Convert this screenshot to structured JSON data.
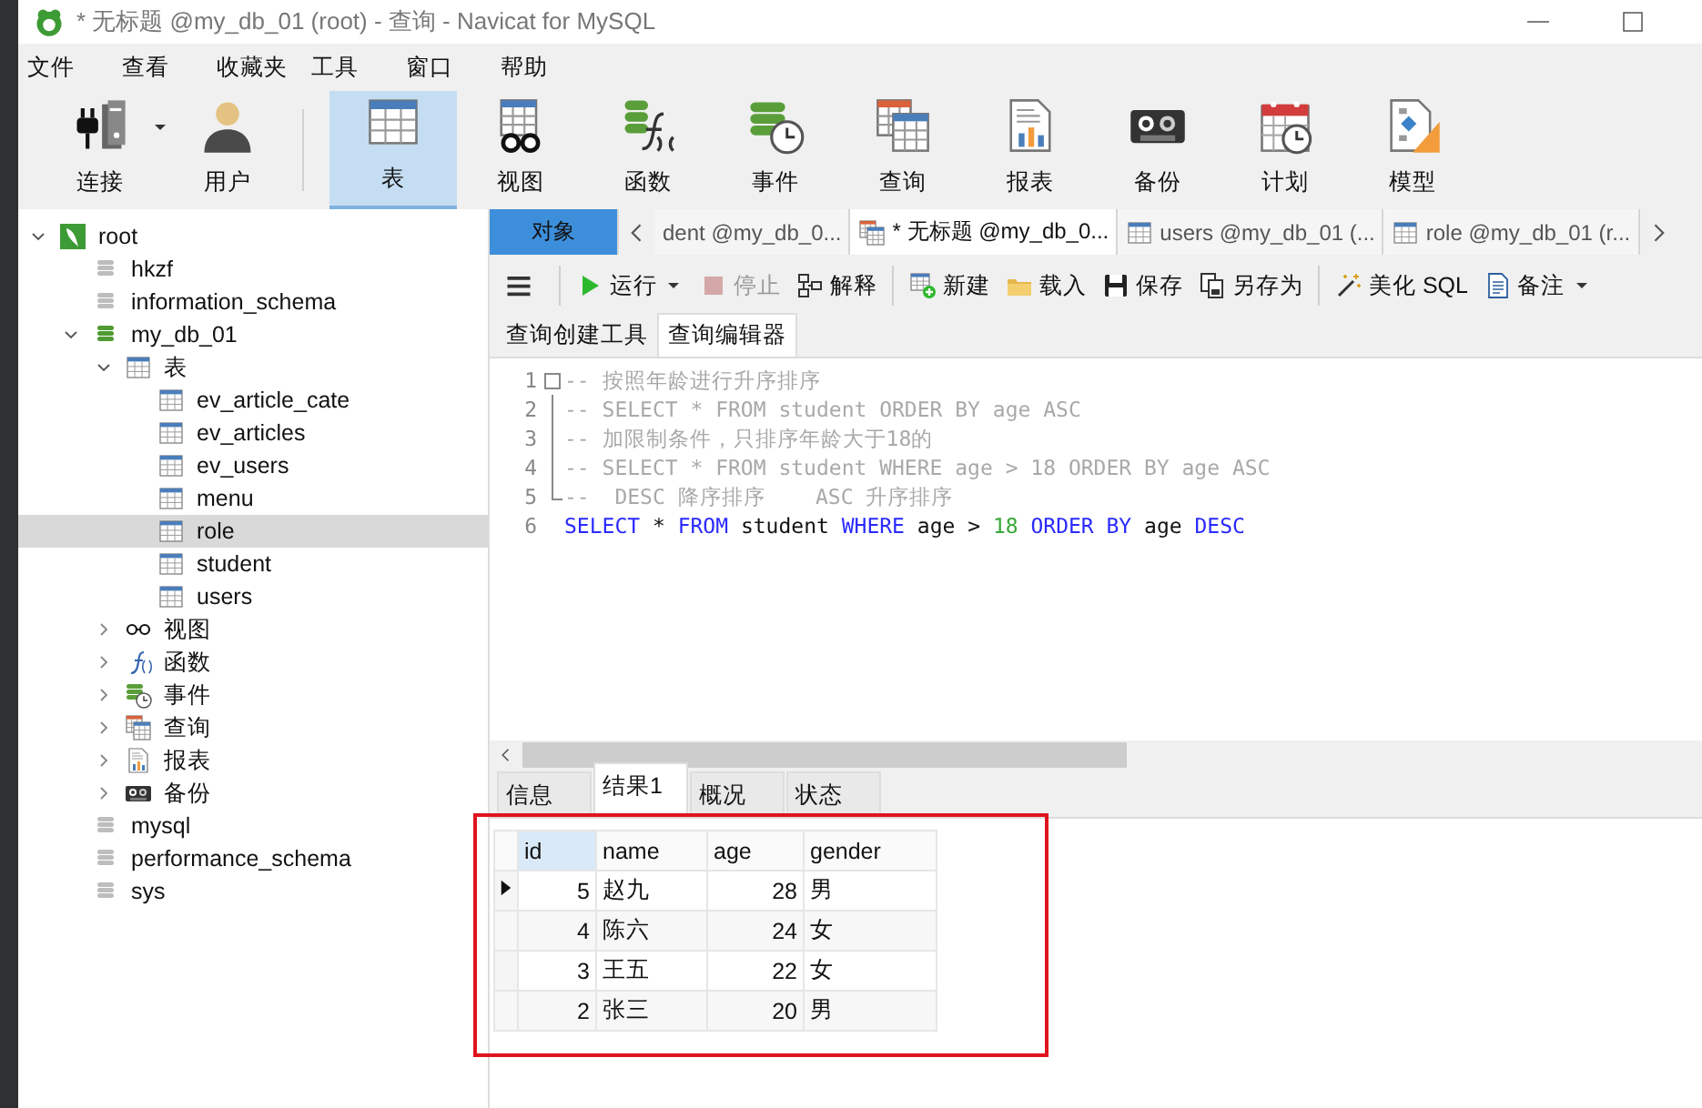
{
  "window": {
    "title": "* 无标题 @my_db_01 (root) - 查询 - Navicat for MySQL"
  },
  "menu": [
    "文件",
    "查看",
    "收藏夹",
    "工具",
    "窗口",
    "帮助"
  ],
  "toolbar": {
    "connection": [
      {
        "kind": "connect",
        "label": "连接",
        "selected": false,
        "dropdown": true
      },
      {
        "kind": "user",
        "label": "用户",
        "selected": false
      }
    ],
    "objects": [
      {
        "kind": "table",
        "label": "表",
        "selected": true
      },
      {
        "kind": "view",
        "label": "视图",
        "selected": false
      },
      {
        "kind": "function",
        "label": "函数",
        "selected": false
      },
      {
        "kind": "event",
        "label": "事件",
        "selected": false
      },
      {
        "kind": "query",
        "label": "查询",
        "selected": false
      },
      {
        "kind": "report",
        "label": "报表",
        "selected": false
      },
      {
        "kind": "backup",
        "label": "备份",
        "selected": false
      },
      {
        "kind": "schedule",
        "label": "计划",
        "selected": false
      },
      {
        "kind": "model",
        "label": "模型",
        "selected": false
      }
    ]
  },
  "tree": [
    {
      "label": "root",
      "kind": "server",
      "expanded": true,
      "children": [
        {
          "label": "hkzf",
          "kind": "db"
        },
        {
          "label": "information_schema",
          "kind": "db"
        },
        {
          "label": "my_db_01",
          "kind": "db-open",
          "expanded": true,
          "children": [
            {
              "label": "表",
              "kind": "tables",
              "expanded": true,
              "children": [
                {
                  "label": "ev_article_cate",
                  "kind": "table",
                  "selected": false
                },
                {
                  "label": "ev_articles",
                  "kind": "table",
                  "selected": false
                },
                {
                  "label": "ev_users",
                  "kind": "table",
                  "selected": false
                },
                {
                  "label": "menu",
                  "kind": "table",
                  "selected": false
                },
                {
                  "label": "role",
                  "kind": "table",
                  "selected": true
                },
                {
                  "label": "student",
                  "kind": "table",
                  "selected": false
                },
                {
                  "label": "users",
                  "kind": "table",
                  "selected": false
                }
              ]
            },
            {
              "label": "视图",
              "kind": "views",
              "expanded": false
            },
            {
              "label": "函数",
              "kind": "functions",
              "expanded": false
            },
            {
              "label": "事件",
              "kind": "events",
              "expanded": false
            },
            {
              "label": "查询",
              "kind": "queries",
              "expanded": false
            },
            {
              "label": "报表",
              "kind": "reports",
              "expanded": false
            },
            {
              "label": "备份",
              "kind": "backups",
              "expanded": false
            }
          ]
        },
        {
          "label": "mysql",
          "kind": "db"
        },
        {
          "label": "performance_schema",
          "kind": "db"
        },
        {
          "label": "sys",
          "kind": "db"
        }
      ]
    }
  ],
  "query_tabs": [
    {
      "kind": "objects",
      "label": "对象",
      "selected": false
    },
    {
      "kind": "plain",
      "label": "dent @my_db_0...",
      "selected": false
    },
    {
      "kind": "query",
      "label": "* 无标题 @my_db_0...",
      "selected": true
    },
    {
      "kind": "table",
      "label": "users @my_db_01 (...",
      "selected": false
    },
    {
      "kind": "table",
      "label": "role @my_db_01 (r...",
      "selected": false
    }
  ],
  "editor_toolbar": [
    [
      {
        "kind": "run",
        "label": "运行",
        "dropdown": true,
        "disabled": false
      },
      {
        "kind": "stop",
        "label": "停止",
        "disabled": true
      },
      {
        "kind": "explain",
        "label": "解释",
        "disabled": false
      }
    ],
    [
      {
        "kind": "new",
        "label": "新建",
        "disabled": false
      },
      {
        "kind": "load",
        "label": "载入",
        "disabled": false
      },
      {
        "kind": "save",
        "label": "保存",
        "disabled": false
      },
      {
        "kind": "save-as",
        "label": "另存为",
        "disabled": false
      }
    ],
    [
      {
        "kind": "beautify",
        "label": "美化 SQL",
        "disabled": false
      },
      {
        "kind": "notes",
        "label": "备注",
        "dropdown": true,
        "disabled": false
      }
    ]
  ],
  "editor_tabs": [
    {
      "label": "查询创建工具",
      "selected": false
    },
    {
      "label": "查询编辑器",
      "selected": true
    }
  ],
  "editor": {
    "lines": [
      {
        "number": "1",
        "kind": "fold-start",
        "tokens": [
          {
            "kind": "comment",
            "text": "-- 按照年龄进行升序排序"
          }
        ]
      },
      {
        "number": "2",
        "kind": "fold-body",
        "tokens": [
          {
            "kind": "comment",
            "text": "-- SELECT * FROM student ORDER BY age ASC"
          }
        ]
      },
      {
        "number": "3",
        "kind": "fold-body",
        "tokens": [
          {
            "kind": "comment",
            "text": "-- 加限制条件，只排序年龄大于18的"
          }
        ]
      },
      {
        "number": "4",
        "kind": "fold-body",
        "tokens": [
          {
            "kind": "comment",
            "text": "-- SELECT * FROM student WHERE age > 18 ORDER BY age ASC"
          }
        ]
      },
      {
        "number": "5",
        "kind": "fold-end",
        "tokens": [
          {
            "kind": "comment",
            "text": "--  DESC 降序排序    ASC 升序排序"
          }
        ]
      },
      {
        "number": "6",
        "kind": "plain",
        "tokens": [
          {
            "kind": "keyword",
            "text": "SELECT"
          },
          {
            "kind": "plain",
            "text": " * "
          },
          {
            "kind": "keyword",
            "text": "FROM"
          },
          {
            "kind": "plain",
            "text": " student "
          },
          {
            "kind": "keyword",
            "text": "WHERE"
          },
          {
            "kind": "plain",
            "text": " age > "
          },
          {
            "kind": "number",
            "text": "18"
          },
          {
            "kind": "keyword",
            "text": " ORDER BY"
          },
          {
            "kind": "plain",
            "text": " age "
          },
          {
            "kind": "keyword",
            "text": "DESC"
          }
        ]
      }
    ]
  },
  "result_tabs": [
    {
      "label": "信息",
      "selected": false
    },
    {
      "label": "结果1",
      "selected": true
    },
    {
      "label": "概况",
      "selected": false
    },
    {
      "label": "状态",
      "selected": false
    }
  ],
  "result_grid": {
    "columns": [
      {
        "label": "id",
        "numeric": true,
        "selected": true
      },
      {
        "label": "name",
        "numeric": false,
        "selected": false
      },
      {
        "label": "age",
        "numeric": true,
        "selected": false
      },
      {
        "label": "gender",
        "numeric": false,
        "selected": false
      }
    ],
    "rows": [
      {
        "current": true,
        "cells": [
          "5",
          "赵九",
          "28",
          "男"
        ]
      },
      {
        "current": false,
        "cells": [
          "4",
          "陈六",
          "24",
          "女"
        ]
      },
      {
        "current": false,
        "cells": [
          "3",
          "王五",
          "22",
          "女"
        ]
      },
      {
        "current": false,
        "cells": [
          "2",
          "张三",
          "20",
          "男"
        ]
      }
    ]
  }
}
